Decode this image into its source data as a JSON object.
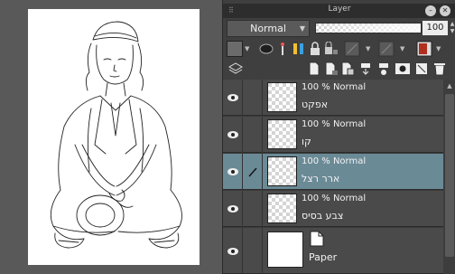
{
  "panel": {
    "title": "Layer"
  },
  "blend": {
    "mode": "Normal",
    "opacity_value": "100",
    "opacity_fraction": 1.0
  },
  "icons": {
    "titlebar": [
      "grip-icon",
      "minimize-icon",
      "close-icon"
    ],
    "tools": [
      "color-chip-icon",
      "mask-icon",
      "reference-icon",
      "color-pencil-icon",
      "lock-icon",
      "lock-transparent-icon",
      "layer-color-icon",
      "palette-color-icon"
    ],
    "actions": [
      "layer-stack-icon",
      "new-layer-icon",
      "new-vector-layer-icon",
      "new-folder-icon",
      "merge-down-icon",
      "transfer-down-icon",
      "mask-layer-icon",
      "delete-layer-icon"
    ]
  },
  "layers": [
    {
      "mode": "100 % Normal",
      "name": "אפקט",
      "visible": true,
      "selected": false,
      "thumb": "transparent"
    },
    {
      "mode": "100 % Normal",
      "name": "קו",
      "visible": true,
      "selected": false,
      "thumb": "transparent"
    },
    {
      "mode": "100 % Normal",
      "name": "ארר רצל",
      "visible": true,
      "selected": true,
      "thumb": "transparent"
    },
    {
      "mode": "100 % Normal",
      "name": "צבע בסיס",
      "visible": true,
      "selected": false,
      "thumb": "transparent"
    },
    {
      "mode": "",
      "name": "Paper",
      "visible": true,
      "selected": false,
      "thumb": "white"
    }
  ]
}
